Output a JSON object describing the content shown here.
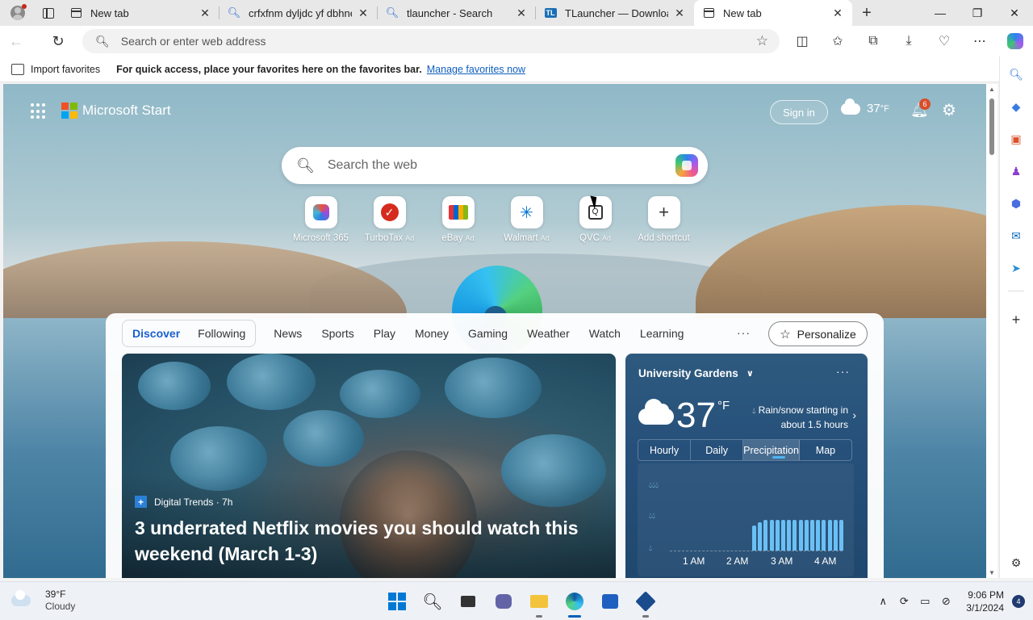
{
  "tabs": [
    {
      "title": "New tab",
      "icon": "newtab-icon",
      "active": false
    },
    {
      "title": "crfxfnm dyljdc yf dbhnefk",
      "icon": "search-icon",
      "active": false
    },
    {
      "title": "tlauncher - Search",
      "icon": "search-icon",
      "active": false
    },
    {
      "title": "TLauncher — Download",
      "icon": "tlauncher-icon",
      "icon_text": "TL",
      "active": false
    },
    {
      "title": "New tab",
      "icon": "newtab-icon",
      "active": true
    }
  ],
  "addressbar": {
    "placeholder": "Search or enter web address"
  },
  "favorites_bar": {
    "import_label": "Import favorites",
    "message": "For quick access, place your favorites here on the favorites bar.",
    "manage_link": "Manage favorites now"
  },
  "ms_start": {
    "brand": "Microsoft Start",
    "sign_in": "Sign in",
    "temp": "37",
    "unit": "°F",
    "notifications": "6"
  },
  "search": {
    "placeholder": "Search the web"
  },
  "shortcuts": [
    {
      "label": "Microsoft 365",
      "ad": ""
    },
    {
      "label": "TurboTax",
      "ad": "Ad"
    },
    {
      "label": "eBay",
      "ad": "Ad"
    },
    {
      "label": "Walmart",
      "ad": "Ad"
    },
    {
      "label": "QVC",
      "ad": "Ad"
    },
    {
      "label": "Add shortcut",
      "ad": ""
    }
  ],
  "feed": {
    "toggle": [
      "Discover",
      "Following"
    ],
    "categories": [
      "News",
      "Sports",
      "Play",
      "Money",
      "Gaming",
      "Weather",
      "Watch",
      "Learning"
    ],
    "more": "···",
    "personalize": "Personalize",
    "hero": {
      "source": "Digital Trends · 7h",
      "title": "3 underrated Netflix movies you should watch this weekend (March 1-3)"
    }
  },
  "weather_card": {
    "location": "University Gardens",
    "temp": "37",
    "unit": "°F",
    "description": "Rain/snow starting in about 1.5 hours",
    "tabs": [
      "Hourly",
      "Daily",
      "Precipitation",
      "Map"
    ],
    "active_tab": "Precipitation",
    "x_labels": [
      "1 AM",
      "2 AM",
      "3 AM",
      "4 AM"
    ],
    "precip_levels": [
      0.45,
      0.5,
      0.55,
      0.55,
      0.55,
      0.55,
      0.55,
      0.55,
      0.55,
      0.55,
      0.55,
      0.55,
      0.55,
      0.55,
      0.55,
      0.55
    ]
  },
  "taskbar": {
    "weather_temp": "39°F",
    "weather_desc": "Cloudy",
    "time": "9:06 PM",
    "date": "3/1/2024",
    "notifications": "4"
  }
}
